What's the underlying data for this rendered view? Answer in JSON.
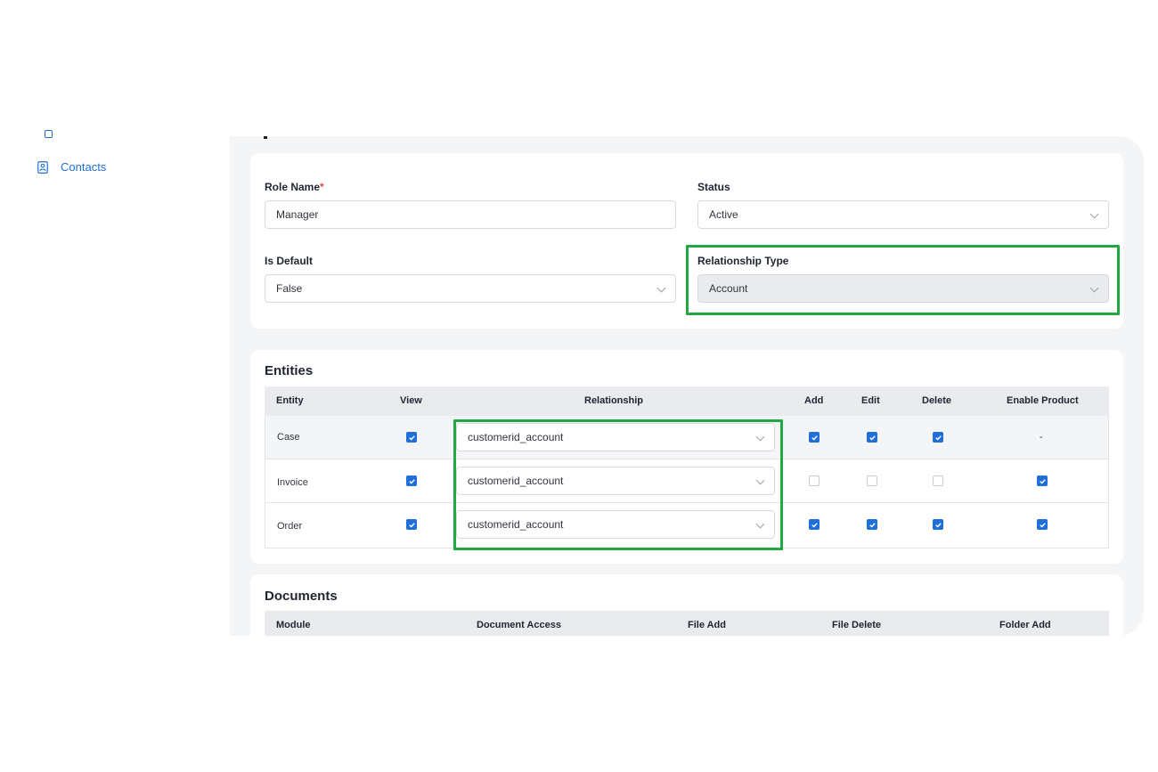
{
  "sidebar": {
    "items": [
      {
        "label": "Contacts",
        "icon": "contact-card-icon"
      }
    ]
  },
  "form": {
    "role_name_label": "Role Name",
    "role_name_required": "*",
    "role_name_value": "Manager",
    "status_label": "Status",
    "status_value": "Active",
    "is_default_label": "Is Default",
    "is_default_value": "False",
    "relationship_type_label": "Relationship Type",
    "relationship_type_value": "Account"
  },
  "entities": {
    "title": "Entities",
    "columns": [
      "Entity",
      "View",
      "Relationship",
      "Add",
      "Edit",
      "Delete",
      "Enable Product"
    ],
    "rows": [
      {
        "entity": "Case",
        "view": true,
        "relationship": "customerid_account",
        "add": true,
        "edit": true,
        "delete": true,
        "enable_product": "-"
      },
      {
        "entity": "Invoice",
        "view": true,
        "relationship": "customerid_account",
        "add": false,
        "edit": false,
        "delete": false,
        "enable_product": true
      },
      {
        "entity": "Order",
        "view": true,
        "relationship": "customerid_account",
        "add": true,
        "edit": true,
        "delete": true,
        "enable_product": true
      }
    ]
  },
  "documents": {
    "title": "Documents",
    "columns": [
      "Module",
      "Document Access",
      "File Add",
      "File Delete",
      "Folder Add"
    ]
  },
  "colors": {
    "accent": "#1f6fd8",
    "highlight": "#22a843",
    "required": "#e14b3b"
  }
}
